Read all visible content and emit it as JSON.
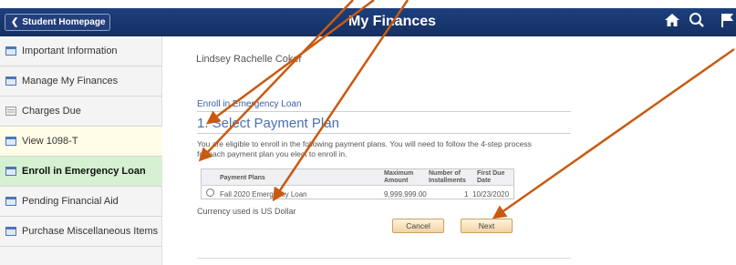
{
  "header": {
    "home_button": "Student Homepage",
    "title": "My Finances"
  },
  "sidebar": {
    "items": [
      {
        "label": "Important Information"
      },
      {
        "label": "Manage My Finances"
      },
      {
        "label": "Charges Due"
      },
      {
        "label": "View 1098-T"
      },
      {
        "label": "Enroll in Emergency Loan"
      },
      {
        "label": "Pending Financial Aid"
      },
      {
        "label": "Purchase Miscellaneous Items"
      }
    ],
    "active_index": 4
  },
  "main": {
    "user_name": "Lindsey Rachelle Coker",
    "section_link": "Enroll in Emergency Loan",
    "heading": "1. Select Payment Plan",
    "description": "You are eligible to enroll in the following payment plans. You will need to follow the 4-step process for each payment plan you elect to enroll in.",
    "table": {
      "headers": {
        "plans": "Payment Plans",
        "max_amount": "Maximum Amount",
        "installments": "Number of Installments",
        "first_due": "First Due Date"
      },
      "rows": [
        {
          "plan": "Fall 2020 Emergency Loan",
          "max_amount": "9,999,999.00",
          "installments": "1",
          "first_due": "10/23/2020"
        }
      ]
    },
    "currency_note": "Currency used is US Dollar",
    "cancel_label": "Cancel",
    "next_label": "Next"
  },
  "colors": {
    "header_bg": "#1a3a73",
    "active_nav_bg": "#d6f0d2",
    "annotation_arrow": "#c85a10"
  },
  "icons": [
    "chevron-left-icon",
    "home-icon",
    "search-icon",
    "flag-icon",
    "folder-icon"
  ]
}
